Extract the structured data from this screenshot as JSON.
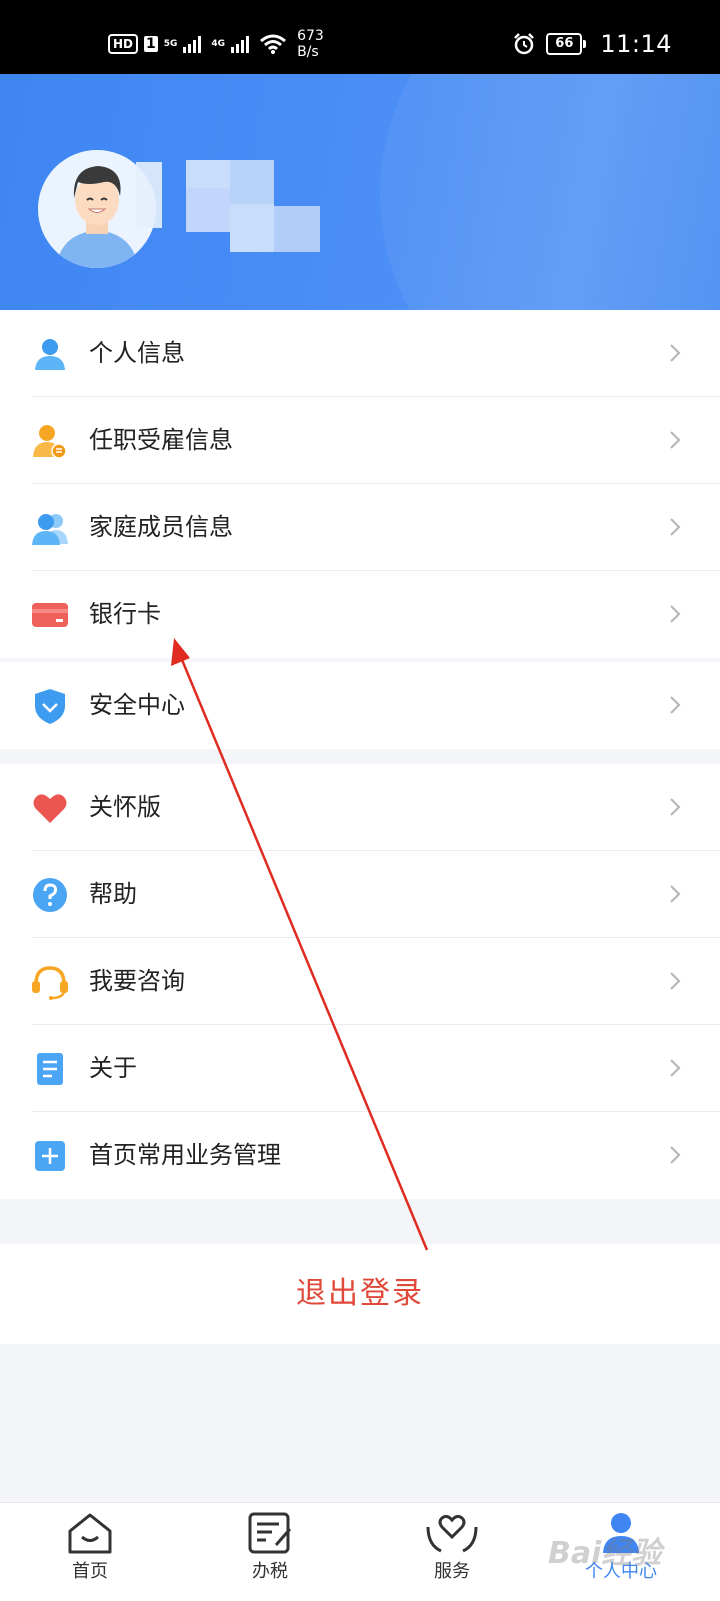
{
  "status_bar": {
    "hd": "HD",
    "sim1": "1",
    "net1": "5G",
    "net2": "4G",
    "speed_value": "673",
    "speed_unit": "B/s",
    "battery": "66",
    "time": "11:14"
  },
  "menu_group1": [
    {
      "label": "个人信息",
      "icon": "person-icon"
    },
    {
      "label": "任职受雇信息",
      "icon": "employment-icon"
    },
    {
      "label": "家庭成员信息",
      "icon": "family-icon"
    },
    {
      "label": "银行卡",
      "icon": "bank-card-icon"
    }
  ],
  "menu_group2": [
    {
      "label": "安全中心",
      "icon": "shield-icon"
    }
  ],
  "menu_group3": [
    {
      "label": "关怀版",
      "icon": "heart-icon"
    },
    {
      "label": "帮助",
      "icon": "help-icon"
    },
    {
      "label": "我要咨询",
      "icon": "headset-icon"
    },
    {
      "label": "关于",
      "icon": "document-icon"
    },
    {
      "label": "首页常用业务管理",
      "icon": "plus-icon"
    }
  ],
  "logout_label": "退出登录",
  "tabs": [
    {
      "label": "首页",
      "icon": "home-icon"
    },
    {
      "label": "办税",
      "icon": "tax-form-icon"
    },
    {
      "label": "服务",
      "icon": "service-heart-icon"
    },
    {
      "label": "个人中心",
      "icon": "profile-icon",
      "active": true
    }
  ],
  "colors": {
    "header_blue": "#3f86f3",
    "logout_red": "#e0493a",
    "arrow_red": "#e02b20"
  }
}
